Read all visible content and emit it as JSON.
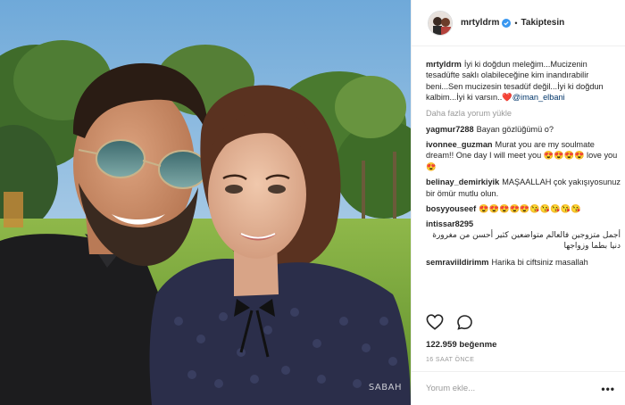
{
  "header": {
    "username": "mrtyldrm",
    "verified": true,
    "separator": "•",
    "follow_status": "Takiptesin"
  },
  "caption": {
    "username": "mrtyldrm",
    "text": "İyi ki doğdun meleğim...Mucizenin tesadüfte saklı olabileceğine kim inandırabilir beni...Sen mucizesin tesadüf değil...İyi ki doğdun kalbim...İyi ki varsın..",
    "emoji": "❤️",
    "mention": "@iman_elbani"
  },
  "load_more_label": "Daha fazla yorum yükle",
  "comments": [
    {
      "username": "yagmur7288",
      "text": "Bayan gözlüğümü o?"
    },
    {
      "username": "ivonnee_guzman",
      "text": "Murat you are my soulmate dream!! One day I will meet you 😍😍😍😍 love you 😍"
    },
    {
      "username": "belinay_demirkiyik",
      "text": "MAŞAALLAH çok yakışıyosunuz bir ömür mutlu olun."
    },
    {
      "username": "bosyyouseef",
      "text": "😍😍😍😍😍😘😘😘😘😘"
    },
    {
      "username": "intissar8295",
      "text": "أجمل متزوجين فالعالم متواضعين كثير أحسن من مغرورة دنيا بطما وزواجها"
    },
    {
      "username": "semraviildirimm",
      "text": "Harika bi ciftsiniz masallah"
    }
  ],
  "likes": {
    "count": "122.959",
    "label": "beğenme"
  },
  "timestamp": "16 SAAT ÖNCE",
  "comment_input": {
    "placeholder": "Yorum ekle..."
  },
  "more_options": "•••",
  "photo_watermark": "SABAH",
  "icons": {
    "like": "heart-icon",
    "comment": "speech-bubble-icon",
    "verified": "verified-badge-icon",
    "more": "more-options-icon"
  },
  "colors": {
    "verified": "#3897f0",
    "link": "#003569",
    "muted": "#999999",
    "border": "#efefef"
  }
}
